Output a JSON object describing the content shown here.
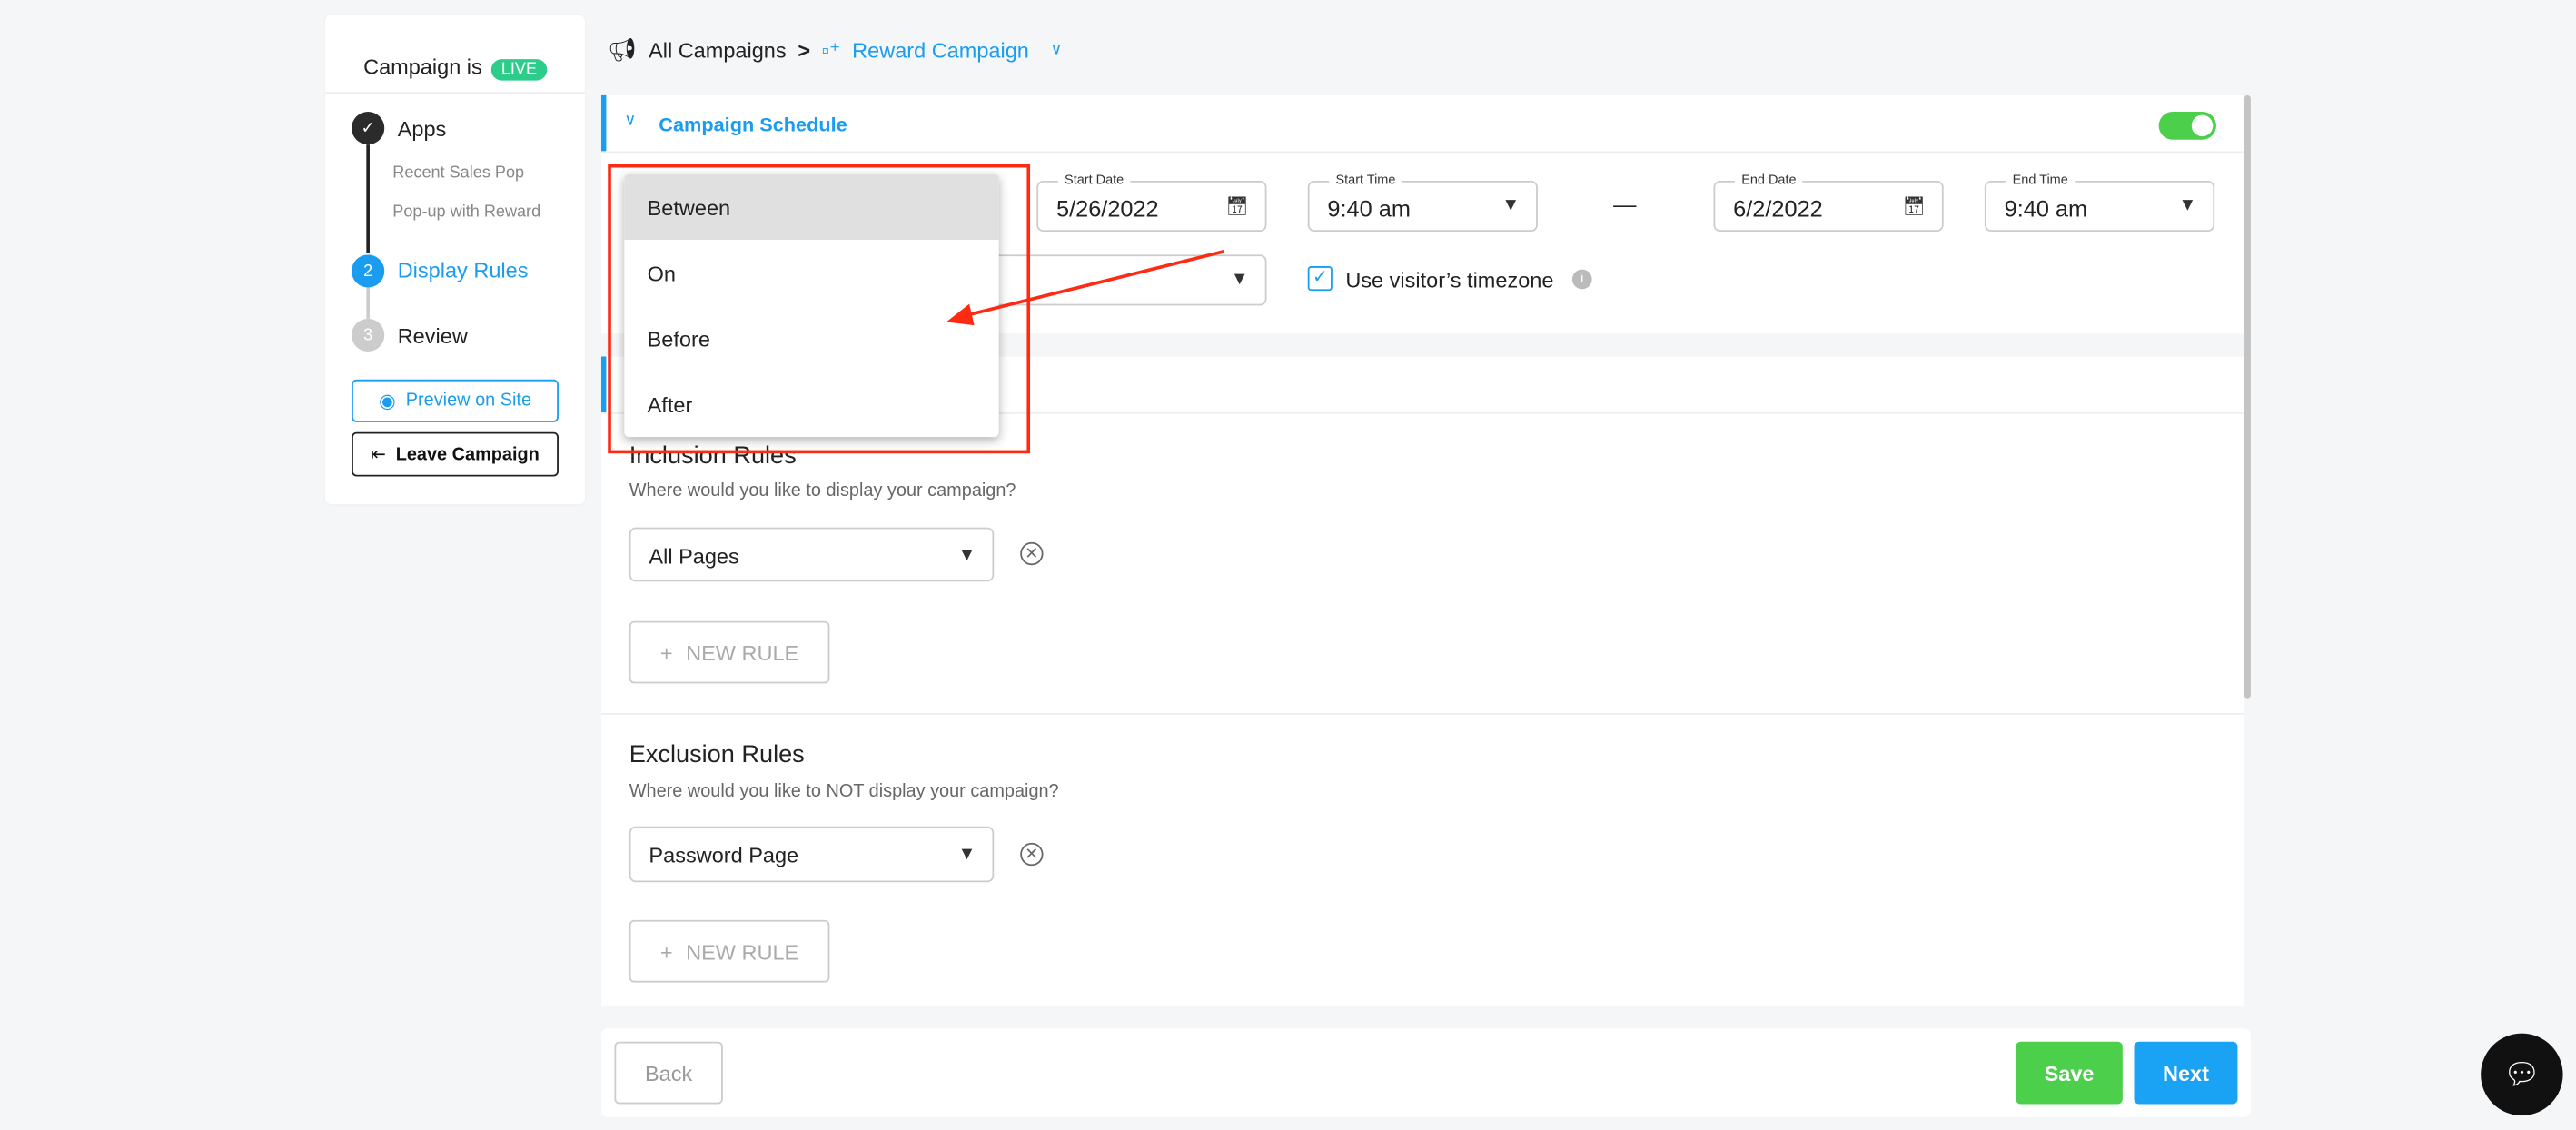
{
  "sidebar": {
    "status_prefix": "Campaign is",
    "status_badge": "LIVE",
    "steps": [
      {
        "label": "Apps",
        "marker": "✓",
        "subitems": [
          "Recent Sales Pop",
          "Pop-up with Reward"
        ]
      },
      {
        "label": "Display Rules",
        "marker": "2"
      },
      {
        "label": "Review",
        "marker": "3"
      }
    ],
    "preview_label": "Preview on Site",
    "leave_label": "Leave Campaign"
  },
  "breadcrumb": {
    "root": "All Campaigns",
    "separator": ">",
    "current": "Reward Campaign"
  },
  "schedule": {
    "title": "Campaign Schedule",
    "enabled": true,
    "start_date": {
      "label": "Start Date",
      "value": "5/26/2022"
    },
    "start_time": {
      "label": "Start Time",
      "value": "9:40 am"
    },
    "dash": "—",
    "end_date": {
      "label": "End Date",
      "value": "6/2/2022"
    },
    "end_time": {
      "label": "End Time",
      "value": "9:40 am"
    },
    "timezone_label": "Use visitor’s timezone",
    "timezone_checked": true
  },
  "dropdown": {
    "options": [
      "Between",
      "On",
      "Before",
      "After"
    ],
    "highlighted": "Between"
  },
  "inclusion": {
    "title": "Inclusion Rules",
    "subtitle": "Where would you like to display your campaign?",
    "select_value": "All Pages",
    "new_rule": "NEW RULE"
  },
  "exclusion": {
    "title": "Exclusion Rules",
    "subtitle": "Where would you like to NOT display your campaign?",
    "select_value": "Password Page",
    "new_rule": "NEW RULE"
  },
  "footer": {
    "back": "Back",
    "save": "Save",
    "next": "Next"
  },
  "colors": {
    "accent": "#1a9cf0",
    "live": "#2ecc8a",
    "save": "#4cd04c",
    "next": "#1aa3f5",
    "annotation": "#ff2a12"
  }
}
